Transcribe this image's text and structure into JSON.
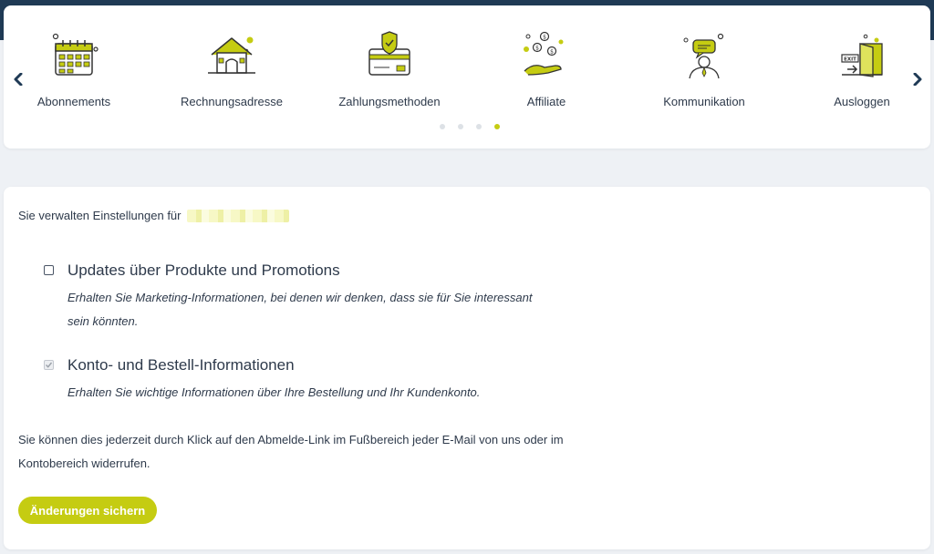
{
  "nav": {
    "items": [
      {
        "label": "Abonnements",
        "icon": "calendar-icon"
      },
      {
        "label": "Rechnungsadresse",
        "icon": "house-icon"
      },
      {
        "label": "Zahlungsmethoden",
        "icon": "payment-card-icon"
      },
      {
        "label": "Affiliate",
        "icon": "coins-hand-icon"
      },
      {
        "label": "Kommunikation",
        "icon": "chat-person-icon"
      },
      {
        "label": "Ausloggen",
        "icon": "exit-door-icon"
      }
    ],
    "active_dot": 4,
    "dot_count": 4
  },
  "settings": {
    "intro": "Sie verwalten Einstellungen für",
    "options": [
      {
        "title": "Updates über Produkte und Promotions",
        "desc": "Erhalten Sie Marketing-Informationen, bei denen wir denken, dass sie für Sie interessant sein könnten.",
        "checked": false,
        "disabled": false
      },
      {
        "title": "Konto- und Bestell-Informationen",
        "desc": "Erhalten Sie wichtige Informationen über Ihre Bestellung und Ihr Kundenkonto.",
        "checked": true,
        "disabled": true
      }
    ],
    "notice": "Sie können dies jederzeit durch Klick auf den Abmelde-Link im Fußbereich jeder E-Mail von uns oder im Kontobereich widerrufen.",
    "save_label": "Änderungen sichern"
  },
  "colors": {
    "accent": "#c5cc12",
    "topbar": "#1f3a55",
    "text": "#2e3a4b"
  }
}
